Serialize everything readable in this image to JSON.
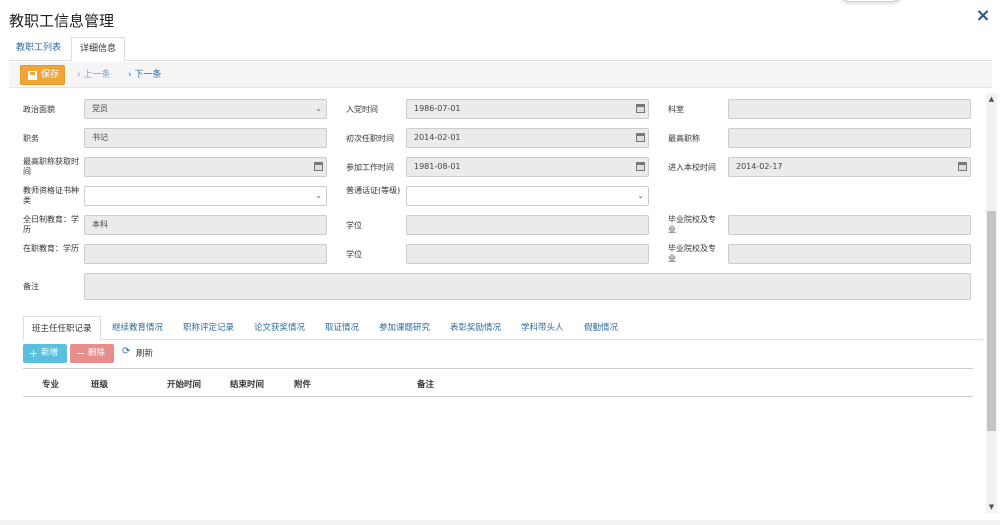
{
  "window": {
    "title": "教职工信息管理",
    "close_icon": "×"
  },
  "tabs": [
    {
      "label": "教职工列表"
    },
    {
      "label": "详细信息"
    }
  ],
  "toolbar": {
    "save_label": "保存",
    "prev_label": "上一条",
    "next_label": "下一条"
  },
  "form": {
    "political_status": {
      "label": "政治面貌",
      "value": "党员"
    },
    "party_join_date": {
      "label": "入党时间",
      "value": "1986-07-01"
    },
    "department": {
      "label": "科室",
      "value": ""
    },
    "position": {
      "label": "职务",
      "value": "书记"
    },
    "first_appointment_date": {
      "label": "初次任职时间",
      "value": "2014-02-01"
    },
    "highest_title": {
      "label": "最高职称",
      "value": ""
    },
    "highest_title_date": {
      "label": "最高职称获取时间",
      "value": ""
    },
    "work_start_date": {
      "label": "参加工作时间",
      "value": "1981-08-01"
    },
    "school_entry_date": {
      "label": "进入本校时间",
      "value": "2014-02-17"
    },
    "teacher_cert_type": {
      "label": "教师资格证书种类",
      "value": ""
    },
    "mandarin_cert": {
      "label": "普通话证(等级)",
      "value": ""
    },
    "fulltime_education": {
      "label": "全日制教育：学历",
      "value": "本科"
    },
    "fulltime_degree": {
      "label": "学位",
      "value": ""
    },
    "fulltime_school_major": {
      "label": "毕业院校及专业",
      "value": ""
    },
    "inservice_education": {
      "label": "在职教育：学历",
      "value": ""
    },
    "inservice_degree": {
      "label": "学位",
      "value": ""
    },
    "inservice_school_major": {
      "label": "毕业院校及专业",
      "value": ""
    },
    "remarks": {
      "label": "备注",
      "value": ""
    }
  },
  "subtabs": [
    {
      "label": "班主任任职记录"
    },
    {
      "label": "继续教育情况"
    },
    {
      "label": "职称评定记录"
    },
    {
      "label": "论文获奖情况"
    },
    {
      "label": "取证情况"
    },
    {
      "label": "参加课题研究"
    },
    {
      "label": "表彰奖励情况"
    },
    {
      "label": "学科带头人"
    },
    {
      "label": "假勤情况"
    }
  ],
  "grid_toolbar": {
    "add_label": "新增",
    "delete_label": "删除",
    "refresh_label": "刷新"
  },
  "grid": {
    "columns": [
      "专业",
      "班级",
      "开始时间",
      "结束时间",
      "附件",
      "备注"
    ]
  },
  "colors": {
    "save": "#f0a535",
    "add": "#5bc0de",
    "delete": "#e78d8b",
    "link": "#2d6aa0"
  }
}
